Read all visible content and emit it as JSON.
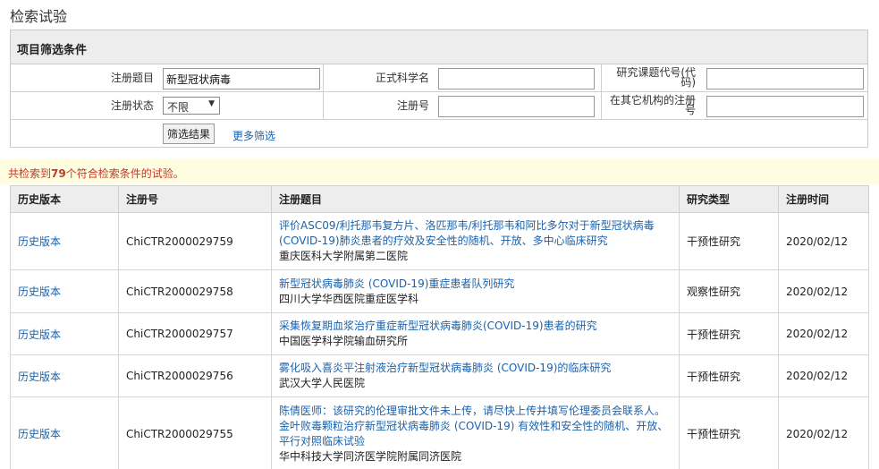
{
  "page": {
    "title": "检索试验"
  },
  "filter": {
    "header": "项目筛选条件",
    "labels": {
      "reg_title": "注册题目",
      "sci_name": "正式科学名",
      "project_code": "研究课题代号(代码)",
      "reg_status": "注册状态",
      "reg_no": "注册号",
      "other_reg": "在其它机构的注册号"
    },
    "values": {
      "reg_title": "新型冠状病毒",
      "sci_name": "",
      "project_code": "",
      "reg_status": "不限",
      "reg_no": "",
      "other_reg": ""
    },
    "submit_label": "筛选结果",
    "more_label": "更多筛选"
  },
  "result": {
    "prefix": "共检索到",
    "count": "79",
    "suffix": "个符合检索条件的试验。"
  },
  "table": {
    "headers": [
      "历史版本",
      "注册号",
      "注册题目",
      "研究类型",
      "注册时间"
    ],
    "rows": [
      {
        "history": "历史版本",
        "reg_no": "ChiCTR2000029759",
        "note": "",
        "title": "评价ASC09/利托那韦复方片、洛匹那韦/利托那韦和阿比多尔对于新型冠状病毒(COVID-19)肺炎患者的疗效及安全性的随机、开放、多中心临床研究",
        "institution": "重庆医科大学附属第二医院",
        "type": "干预性研究",
        "date": "2020/02/12"
      },
      {
        "history": "历史版本",
        "reg_no": "ChiCTR2000029758",
        "note": "",
        "title": "新型冠状病毒肺炎 (COVID-19)重症患者队列研究",
        "institution": "四川大学华西医院重症医学科",
        "type": "观察性研究",
        "date": "2020/02/12"
      },
      {
        "history": "历史版本",
        "reg_no": "ChiCTR2000029757",
        "note": "",
        "title": "采集恢复期血浆治疗重症新型冠状病毒肺炎(COVID-19)患者的研究",
        "institution": "中国医学科学院输血研究所",
        "type": "干预性研究",
        "date": "2020/02/12"
      },
      {
        "history": "历史版本",
        "reg_no": "ChiCTR2000029756",
        "note": "",
        "title": "雾化吸入喜炎平注射液治疗新型冠状病毒肺炎 (COVID-19)的临床研究",
        "institution": "武汉大学人民医院",
        "type": "干预性研究",
        "date": "2020/02/12"
      },
      {
        "history": "历史版本",
        "reg_no": "ChiCTR2000029755",
        "note": "陈倩医师：该研究的伦理审批文件未上传，请尽快上传并填写伦理委员会联系人。",
        "title": "金叶败毒颗粒治疗新型冠状病毒肺炎 (COVID-19) 有效性和安全性的随机、开放、平行对照临床试验",
        "institution": "华中科技大学同济医学院附属同济医院",
        "type": "干预性研究",
        "date": "2020/02/12"
      }
    ]
  }
}
